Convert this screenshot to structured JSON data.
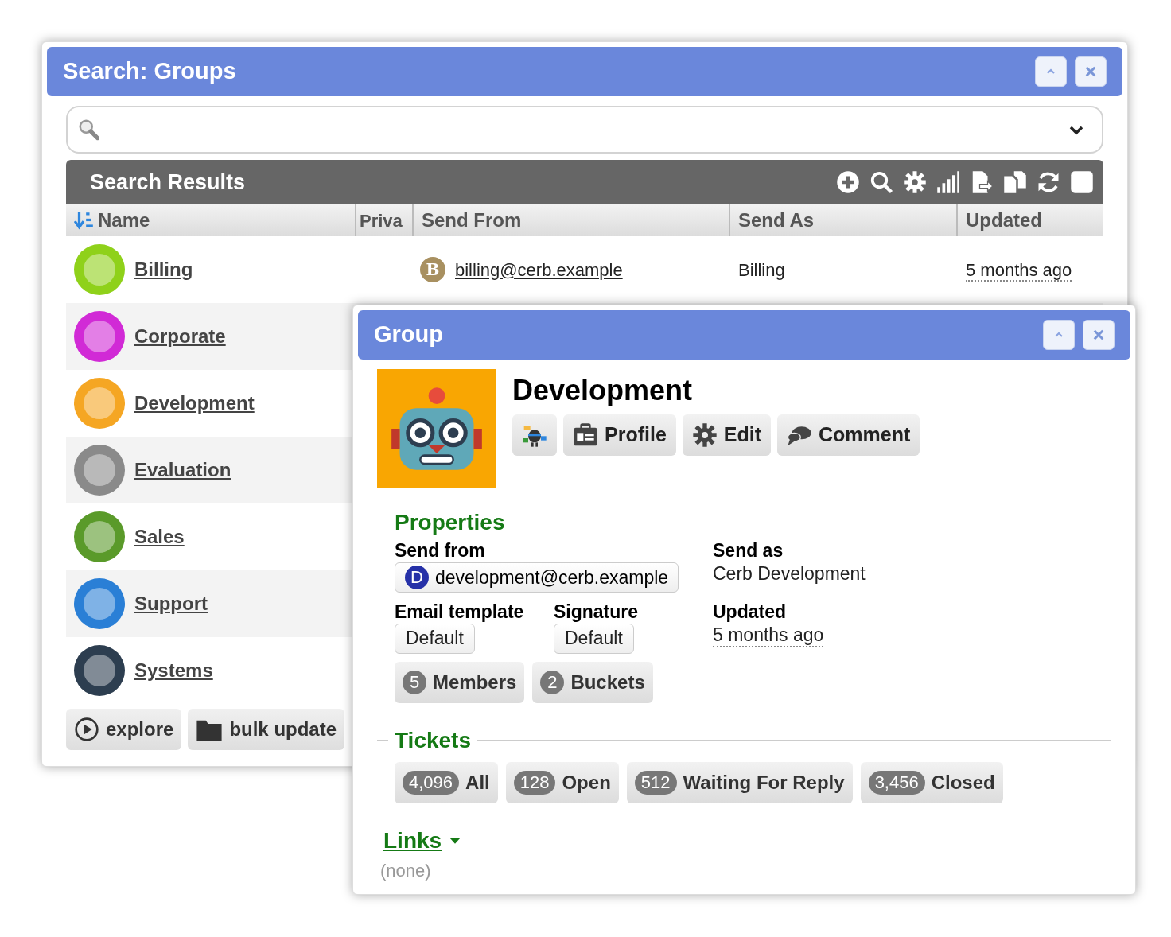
{
  "search_window": {
    "title": "Search: Groups",
    "results": {
      "title": "Search Results",
      "columns": [
        {
          "label": "Name",
          "sorted": true
        },
        {
          "label": "Priva",
          "sorted": false
        },
        {
          "label": "Send From",
          "sorted": false
        },
        {
          "label": "Send As",
          "sorted": false
        },
        {
          "label": "Updated",
          "sorted": false
        }
      ],
      "rows": [
        {
          "name": "Billing",
          "color": "#8fd11a",
          "send_from_initial": "B",
          "send_from": "billing@cerb.example",
          "send_as": "Billing",
          "updated": "5 months ago"
        },
        {
          "name": "Corporate",
          "color": "#d12ad6"
        },
        {
          "name": "Development",
          "color": "#f5a623"
        },
        {
          "name": "Evaluation",
          "color": "#8a8a8a"
        },
        {
          "name": "Sales",
          "color": "#5a9a2a"
        },
        {
          "name": "Support",
          "color": "#2a7fd6"
        },
        {
          "name": "Systems",
          "color": "#2d3e50"
        }
      ]
    },
    "actions": [
      {
        "kind": "explore",
        "label": "explore"
      },
      {
        "kind": "bulk",
        "label": "bulk update"
      }
    ]
  },
  "group_window": {
    "title": "Group",
    "name": "Development",
    "buttons": [
      {
        "kind": "bot"
      },
      {
        "kind": "profile",
        "label": "Profile"
      },
      {
        "kind": "edit",
        "label": "Edit"
      },
      {
        "kind": "comment",
        "label": "Comment"
      }
    ],
    "properties": {
      "title": "Properties",
      "send_from": {
        "label": "Send from",
        "initial": "D",
        "value": "development@cerb.example"
      },
      "send_as": {
        "label": "Send as",
        "value": "Cerb Development"
      },
      "email_template": {
        "label": "Email template",
        "value": "Default"
      },
      "signature": {
        "label": "Signature",
        "value": "Default"
      },
      "updated": {
        "label": "Updated",
        "value": "5 months ago"
      },
      "counts": [
        {
          "count": "5",
          "label": "Members"
        },
        {
          "count": "2",
          "label": "Buckets"
        }
      ]
    },
    "tickets": {
      "title": "Tickets",
      "buttons": [
        {
          "count": "4,096",
          "label": "All"
        },
        {
          "count": "128",
          "label": "Open"
        },
        {
          "count": "512",
          "label": "Waiting For Reply"
        },
        {
          "count": "3,456",
          "label": "Closed"
        }
      ]
    },
    "links": {
      "title": "Links",
      "value": "(none)"
    }
  }
}
